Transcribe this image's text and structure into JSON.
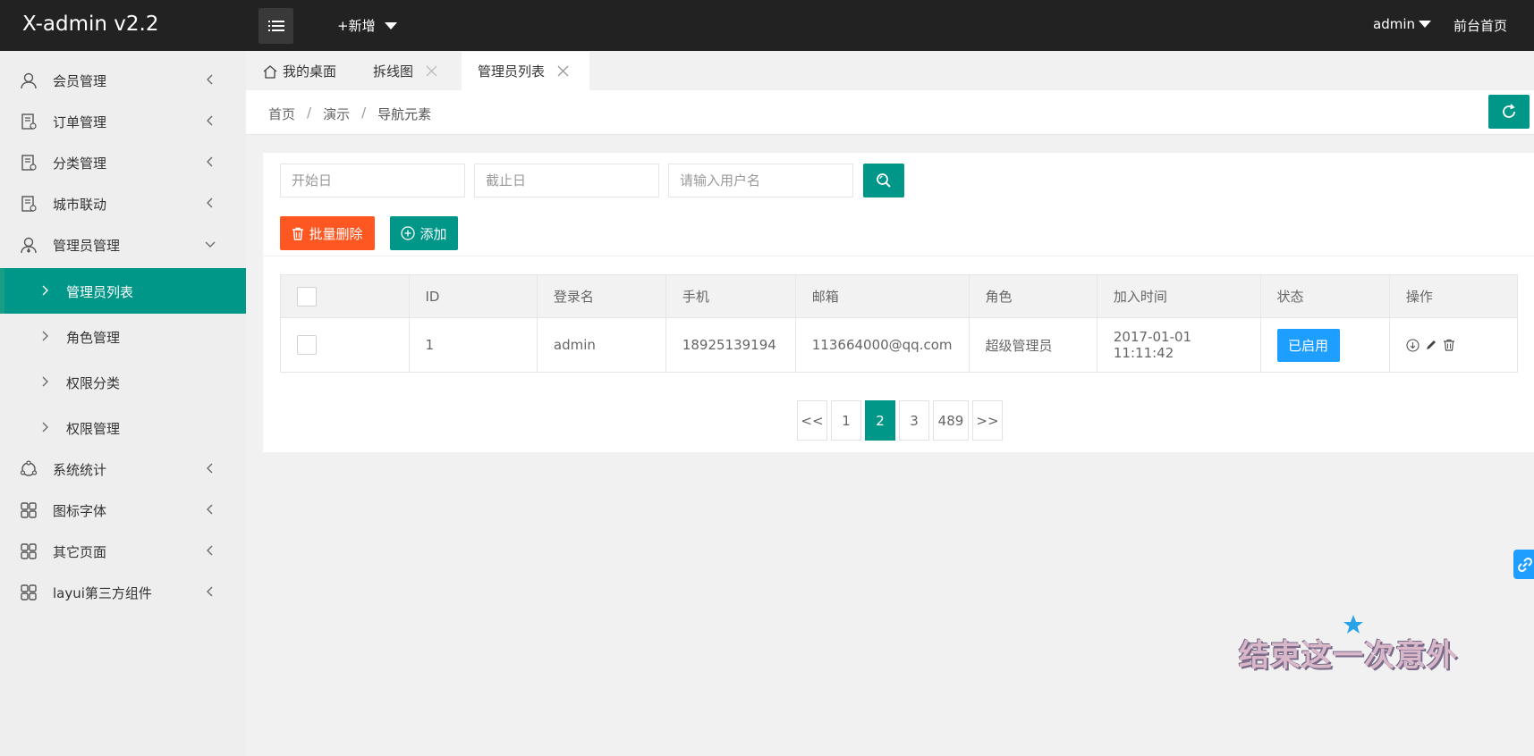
{
  "header": {
    "logo": "X-admin v2.2",
    "new_label": "+新增",
    "user": "admin",
    "home_link": "前台首页"
  },
  "sidebar": {
    "items": [
      {
        "label": "会员管理",
        "icon": "user-icon"
      },
      {
        "label": "订单管理",
        "icon": "order-icon"
      },
      {
        "label": "分类管理",
        "icon": "category-icon"
      },
      {
        "label": "城市联动",
        "icon": "city-icon"
      },
      {
        "label": "管理员管理",
        "icon": "admin-icon"
      },
      {
        "label": "系统统计",
        "icon": "stats-icon"
      },
      {
        "label": "图标字体",
        "icon": "grid-icon"
      },
      {
        "label": "其它页面",
        "icon": "grid-icon"
      },
      {
        "label": "layui第三方组件",
        "icon": "grid-icon"
      }
    ],
    "sub_items": [
      {
        "label": "管理员列表"
      },
      {
        "label": "角色管理"
      },
      {
        "label": "权限分类"
      },
      {
        "label": "权限管理"
      }
    ]
  },
  "tabs": [
    {
      "label": "我的桌面"
    },
    {
      "label": "拆线图"
    },
    {
      "label": "管理员列表"
    }
  ],
  "breadcrumb": {
    "home": "首页",
    "demo": "演示",
    "current": "导航元素",
    "separator": "/"
  },
  "filters": {
    "start_placeholder": "开始日",
    "end_placeholder": "截止日",
    "username_placeholder": "请输入用户名"
  },
  "actions": {
    "batch_delete": "批量删除",
    "add": "添加"
  },
  "table": {
    "headers": [
      "ID",
      "登录名",
      "手机",
      "邮箱",
      "角色",
      "加入时间",
      "状态",
      "操作"
    ],
    "rows": [
      {
        "id": "1",
        "login": "admin",
        "phone": "18925139194",
        "email": "113664000@qq.com",
        "role": "超级管理员",
        "joined": "2017-01-01 11:11:42",
        "status": "已启用"
      }
    ]
  },
  "pagination": {
    "prev": "<<",
    "pages": [
      "1",
      "2",
      "3",
      "489"
    ],
    "next": ">>",
    "current": "2"
  },
  "watermark": "结束这一次意外",
  "colors": {
    "header_bg": "#222222",
    "primary": "#009688",
    "danger": "#ff5722",
    "info": "#1e9fff",
    "sidebar_bg": "#eeeeee"
  }
}
